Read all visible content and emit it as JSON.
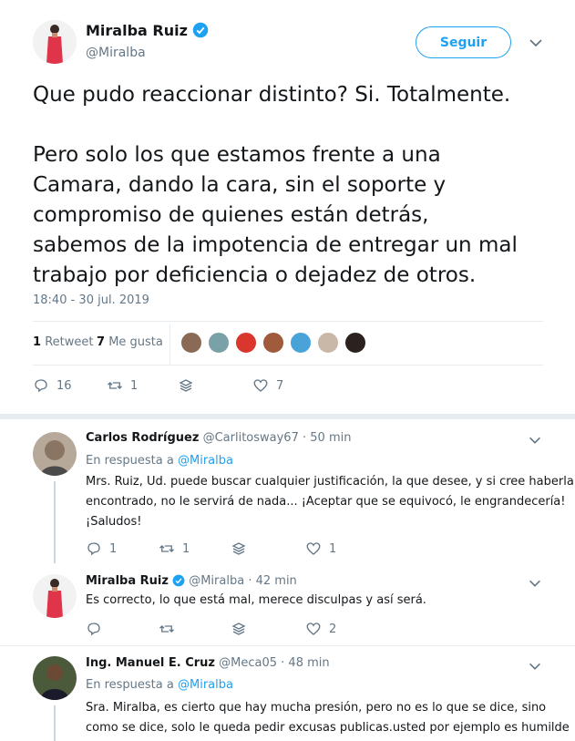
{
  "main_tweet": {
    "author_name": "Miralba Ruiz",
    "handle": "@Miralba",
    "follow_label": "Seguir",
    "text_line1": "Que pudo reaccionar distinto? Si. Totalmente.",
    "text_p2_l1": "Pero solo los que estamos frente a una",
    "text_p2_l2": "Camara, dando la cara, sin el soporte y",
    "text_p2_l3": "compromiso de quienes están detrás,",
    "text_p2_l4": "sabemos de la impotencia de entregar un mal",
    "text_p2_l5": "trabajo por deficiencia o dejadez de otros.",
    "timestamp": "18:40 - 30 jul. 2019",
    "retweets_count": "1",
    "retweets_label": "Retweet",
    "likes_count": "7",
    "likes_label": "Me gusta",
    "action_replies": "16",
    "action_retweets": "1",
    "action_likes": "7"
  },
  "replies": [
    {
      "author_name": "Carlos Rodríguez",
      "handle": "@Carlitosway67",
      "time": "· 50 min",
      "reply_to_prefix": "En respuesta a",
      "reply_to_handle": "@Miralba",
      "text_l1": "Mrs. Ruiz, Ud. puede buscar cualquier justificación, la que desee, y si cree haberla",
      "text_l2": "encontrado, no le servirá de nada... ¡Aceptar que se equivocó, le engrandecería!",
      "text_l3": "¡Saludos!",
      "replies": "1",
      "retweets": "1",
      "likes": "1"
    },
    {
      "author_name": "Miralba Ruiz",
      "handle": "@Miralba",
      "time": "· 42 min",
      "text_l1": "Es correcto, lo que está mal, merece disculpas y así será.",
      "replies": "",
      "retweets": "",
      "likes": "2"
    },
    {
      "author_name": "Ing. Manuel E. Cruz",
      "handle": "@Meca05",
      "time": "· 48 min",
      "reply_to_prefix": "En respuesta a",
      "reply_to_handle": "@Miralba",
      "text_l1": "Sra. Miralba, es cierto que hay mucha presión, pero no es lo que se dice, sino",
      "text_l2": "como se dice, solo le queda pedir excusas publicas.usted por ejemplo es humilde"
    }
  ],
  "colors": {
    "accent": "#1da1f2",
    "muted": "#657786",
    "divider": "#e6ecf0"
  }
}
